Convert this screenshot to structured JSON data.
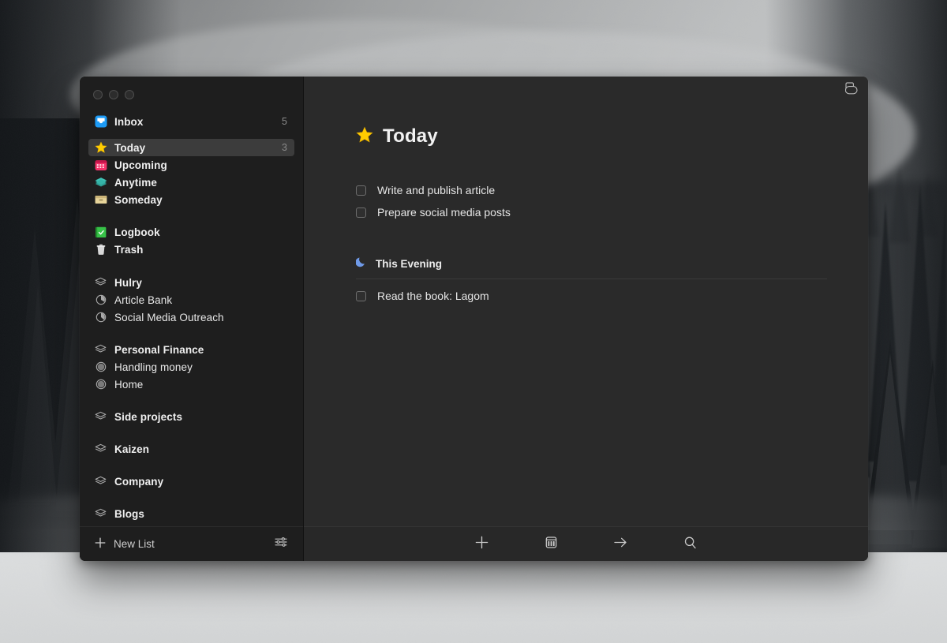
{
  "window": {
    "traffic_lights": [
      "close",
      "minimize",
      "zoom"
    ],
    "quick_find_icon": "duplicate-window-icon"
  },
  "sidebar": {
    "primary_items": [
      {
        "label": "Inbox",
        "icon": "inbox-icon",
        "count": "5",
        "selected": false,
        "bold": true
      },
      {
        "label": "Today",
        "icon": "star-icon",
        "count": "3",
        "selected": true,
        "bold": true
      },
      {
        "label": "Upcoming",
        "icon": "calendar-icon",
        "count": "",
        "selected": false,
        "bold": true
      },
      {
        "label": "Anytime",
        "icon": "layers-icon",
        "count": "",
        "selected": false,
        "bold": true
      },
      {
        "label": "Someday",
        "icon": "box-icon",
        "count": "",
        "selected": false,
        "bold": true
      }
    ],
    "secondary_items": [
      {
        "label": "Logbook",
        "icon": "logbook-icon",
        "count": "",
        "bold": true
      },
      {
        "label": "Trash",
        "icon": "trash-icon",
        "count": "",
        "bold": true
      }
    ],
    "groups": [
      {
        "area": {
          "label": "Hulry",
          "icon": "area-icon"
        },
        "projects": [
          {
            "label": "Article Bank",
            "icon": "project-pie-icon"
          },
          {
            "label": "Social Media Outreach",
            "icon": "project-pie-icon"
          }
        ]
      },
      {
        "area": {
          "label": "Personal Finance",
          "icon": "area-icon"
        },
        "projects": [
          {
            "label": "Handling money",
            "icon": "project-circle-icon"
          },
          {
            "label": "Home",
            "icon": "project-circle-icon"
          }
        ]
      },
      {
        "area": {
          "label": "Side projects",
          "icon": "area-icon"
        },
        "projects": []
      },
      {
        "area": {
          "label": "Kaizen",
          "icon": "area-icon"
        },
        "projects": []
      },
      {
        "area": {
          "label": "Company",
          "icon": "area-icon"
        },
        "projects": []
      },
      {
        "area": {
          "label": "Blogs",
          "icon": "area-icon"
        },
        "projects": []
      }
    ],
    "footer": {
      "new_list_label": "New List",
      "new_list_icon": "plus-icon",
      "settings_icon": "sliders-icon"
    }
  },
  "main": {
    "title": "Today",
    "title_icon": "star-icon",
    "tasks": [
      {
        "title": "Write and publish article",
        "checked": false
      },
      {
        "title": "Prepare social media posts",
        "checked": false
      }
    ],
    "sections": [
      {
        "title": "This Evening",
        "icon": "moon-icon",
        "tasks": [
          {
            "title": "Read the book: Lagom",
            "checked": false
          }
        ]
      }
    ]
  },
  "toolbar": {
    "buttons": [
      {
        "name": "new-todo",
        "icon": "plus-icon"
      },
      {
        "name": "when",
        "icon": "calendar-icon"
      },
      {
        "name": "move",
        "icon": "arrow-right-icon"
      },
      {
        "name": "search",
        "icon": "search-icon"
      }
    ]
  },
  "colors": {
    "sidebar_bg": "#1e1e1e",
    "main_bg": "#2a2a2a",
    "selection": "#3c3c3c",
    "accent_star": "#ffcc00",
    "accent_inbox": "#1d9bf6",
    "accent_upcoming": "#f5326a",
    "accent_anytime": "#3fc2b5",
    "accent_someday": "#e7d49a",
    "accent_logbook": "#37c248",
    "accent_moon": "#6f9ae8",
    "text_primary": "#e8e8e8",
    "text_muted": "#8a8a8a"
  }
}
